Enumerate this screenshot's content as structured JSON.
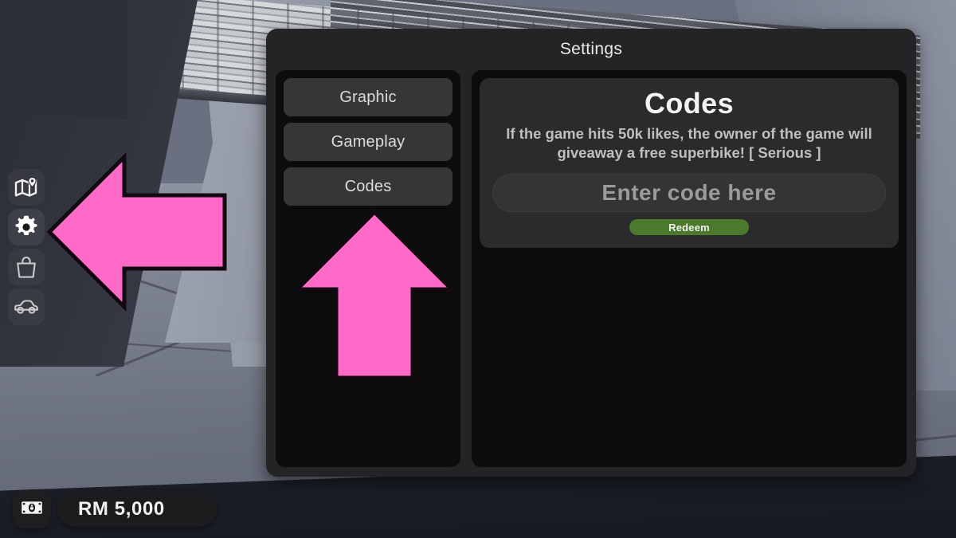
{
  "game": {
    "scene_description": "Roblox garage interior with concrete floor and louvered ceiling"
  },
  "hud": {
    "currency_icon": "banknote-icon",
    "currency_amount": "RM 5,000",
    "rail": [
      {
        "id": "map",
        "icon": "map-location-icon",
        "label": "Map",
        "active": false
      },
      {
        "id": "settings",
        "icon": "gear-icon",
        "label": "Settings",
        "active": true
      },
      {
        "id": "shop",
        "icon": "shopping-bag-icon",
        "label": "Shop",
        "active": false
      },
      {
        "id": "garage",
        "icon": "car-icon",
        "label": "Garage",
        "active": false
      }
    ]
  },
  "settings": {
    "title": "Settings",
    "nav": [
      {
        "id": "graphic",
        "label": "Graphic"
      },
      {
        "id": "gameplay",
        "label": "Gameplay"
      },
      {
        "id": "codes",
        "label": "Codes"
      }
    ],
    "codes_panel": {
      "heading": "Codes",
      "description": "If the game hits 50k likes, the owner of the game will giveaway a free superbike!  [ Serious ]",
      "input_value": "",
      "input_placeholder": "Enter code here",
      "redeem_label": "Redeem"
    }
  },
  "annotations": {
    "arrow_left": {
      "name": "pink-arrow-pointing-to-settings-icon",
      "direction": "left",
      "fill": "#FF69C8",
      "stroke": "#120a10"
    },
    "arrow_up": {
      "name": "pink-arrow-pointing-to-codes-tab",
      "direction": "up",
      "fill": "#FF69C8",
      "stroke": "#120a10"
    }
  },
  "colors": {
    "panel_bg": "#242426",
    "column_bg": "#0c0c0d",
    "nav_button": "#363638",
    "card_bg": "#2b2b2d",
    "input_bg": "#343436",
    "redeem_green": "#4b7a2c",
    "accent_pink": "#FF69C8",
    "text_primary": "#f3f3f3",
    "text_secondary": "#bfbfbf",
    "placeholder": "#9b9b9b"
  }
}
